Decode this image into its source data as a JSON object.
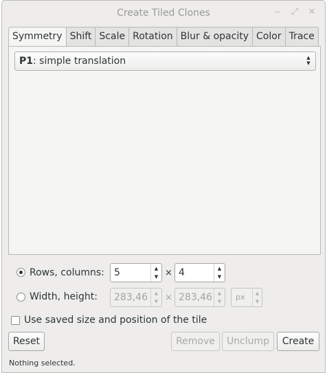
{
  "window": {
    "title": "Create Tiled Clones",
    "controls": {
      "minimize": "⎯",
      "maximize": "⤢",
      "close": "✕"
    }
  },
  "tabs": [
    {
      "label": "Symmetry",
      "active": true
    },
    {
      "label": "Shift"
    },
    {
      "label": "Scale"
    },
    {
      "label": "Rotation"
    },
    {
      "label": "Blur & opacity"
    },
    {
      "label": "Color"
    },
    {
      "label": "Trace"
    }
  ],
  "symmetry": {
    "group_code": "P1",
    "group_desc": ": simple translation"
  },
  "rows_columns": {
    "label": "Rows, columns:",
    "selected": true,
    "rows": "5",
    "columns": "4"
  },
  "width_height": {
    "label": "Width, height:",
    "selected": false,
    "width": "283,46",
    "height": "283,46",
    "unit": "px"
  },
  "times_sign": "×",
  "use_saved": {
    "label": "Use saved size and position of the tile",
    "checked": false
  },
  "buttons": {
    "reset": "Reset",
    "remove": "Remove",
    "unclump": "Unclump",
    "create": "Create"
  },
  "status": "Nothing selected.",
  "icons": {
    "spin_up": "▲",
    "spin_down": "▼"
  }
}
